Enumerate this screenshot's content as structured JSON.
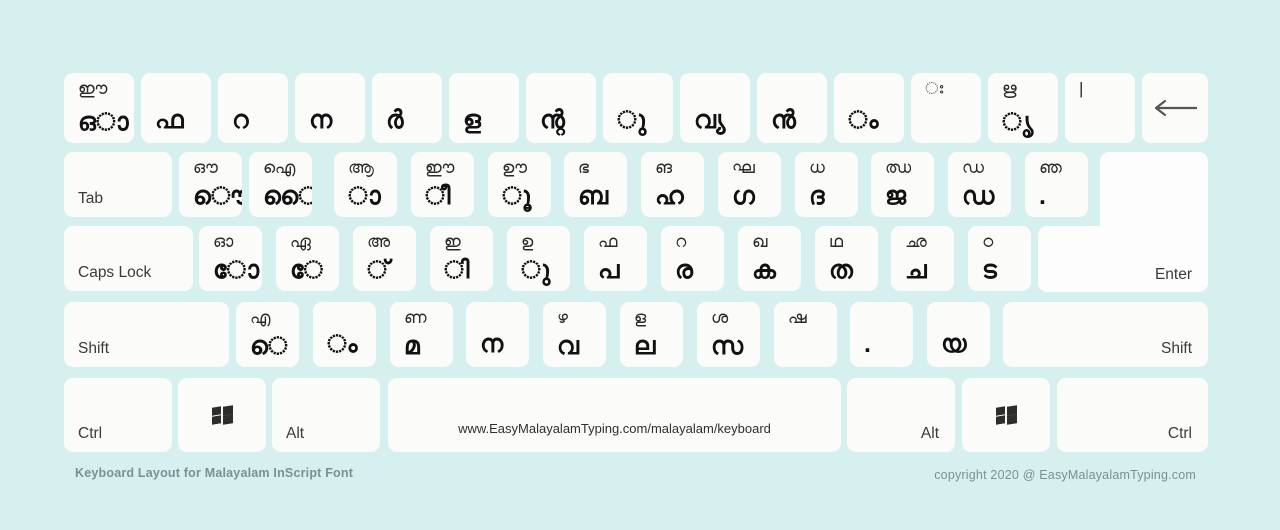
{
  "title": "Keyboard Layout for Malayalam InScript Font",
  "copyright": "copyright 2020 @ EasyMalayalamTyping.com",
  "colors": {
    "background": "#d5f0ef",
    "key": "#fbfbf9",
    "text": "#111111",
    "footer": "#7d8f93"
  },
  "spacebar": {
    "url": "www.EasyMalayalamTyping.com/malayalam/keyboard"
  },
  "rows": {
    "number_row": [
      {
        "top": "ഈ",
        "bottom": "ഒാ"
      },
      {
        "top": "",
        "bottom": "ഫ"
      },
      {
        "top": "",
        "bottom": "റ"
      },
      {
        "top": "",
        "bottom": "ന"
      },
      {
        "top": "",
        "bottom": "ർ"
      },
      {
        "top": "",
        "bottom": "ള"
      },
      {
        "top": "",
        "bottom": "ന്റ"
      },
      {
        "top": "",
        "bottom": "ു"
      },
      {
        "top": "",
        "bottom": "വ്യ"
      },
      {
        "top": "",
        "bottom": "ൻ"
      },
      {
        "top": "",
        "bottom": "ം"
      },
      {
        "top": "ഃ",
        "bottom": ""
      },
      {
        "top": "ഋ",
        "bottom": "ൃ"
      },
      {
        "top": "|",
        "bottom": ""
      }
    ],
    "backspace": {
      "icon": "left-arrow-icon"
    },
    "tab_row": {
      "tab_label": "Tab",
      "keys": [
        {
          "top": "ഔ",
          "bottom": "ൌ"
        },
        {
          "top": "ഐ",
          "bottom": "ൈ"
        },
        {
          "top": "ആ",
          "bottom": "ാ"
        },
        {
          "top": "ഈ",
          "bottom": "ീ"
        },
        {
          "top": "ഊ",
          "bottom": "ൂ"
        },
        {
          "top": "ഭ",
          "bottom": "ബ"
        },
        {
          "top": "ങ",
          "bottom": "ഹ"
        },
        {
          "top": "ഘ",
          "bottom": "ഗ"
        },
        {
          "top": "ധ",
          "bottom": "ദ"
        },
        {
          "top": "ഝ",
          "bottom": "ജ"
        },
        {
          "top": "ഡ",
          "bottom": "ഡ"
        },
        {
          "top": "ഞ",
          "bottom": "."
        }
      ]
    },
    "caps_row": {
      "caps_label": "Caps Lock",
      "keys": [
        {
          "top": "ഓ",
          "bottom": "ോ"
        },
        {
          "top": "ഏ",
          "bottom": "േ"
        },
        {
          "top": "അ",
          "bottom": "്"
        },
        {
          "top": "ഇ",
          "bottom": "ി"
        },
        {
          "top": "ഉ",
          "bottom": "ു"
        },
        {
          "top": "ഫ",
          "bottom": "പ"
        },
        {
          "top": "റ",
          "bottom": "ര"
        },
        {
          "top": "ഖ",
          "bottom": "ക"
        },
        {
          "top": "ഥ",
          "bottom": "ത"
        },
        {
          "top": "ഛ",
          "bottom": "ച"
        },
        {
          "top": "ഠ",
          "bottom": "ട"
        }
      ],
      "enter_label": "Enter"
    },
    "shift_row": {
      "shift_left": "Shift",
      "shift_right": "Shift",
      "keys": [
        {
          "top": "എ",
          "bottom": "െ"
        },
        {
          "top": "",
          "bottom": "ം"
        },
        {
          "top": "ണ",
          "bottom": "മ"
        },
        {
          "top": "",
          "bottom": "ന"
        },
        {
          "top": "ഴ",
          "bottom": "വ"
        },
        {
          "top": "ള",
          "bottom": "ല"
        },
        {
          "top": "ശ",
          "bottom": "സ"
        },
        {
          "top": "ഷ",
          "bottom": ""
        },
        {
          "top": "",
          "bottom": "."
        },
        {
          "top": "",
          "bottom": "യ"
        }
      ]
    },
    "bottom_row": {
      "ctrl_left": "Ctrl",
      "win_left": "windows-icon",
      "alt_left": "Alt",
      "alt_right": "Alt",
      "win_right": "windows-icon",
      "ctrl_right": "Ctrl"
    }
  }
}
